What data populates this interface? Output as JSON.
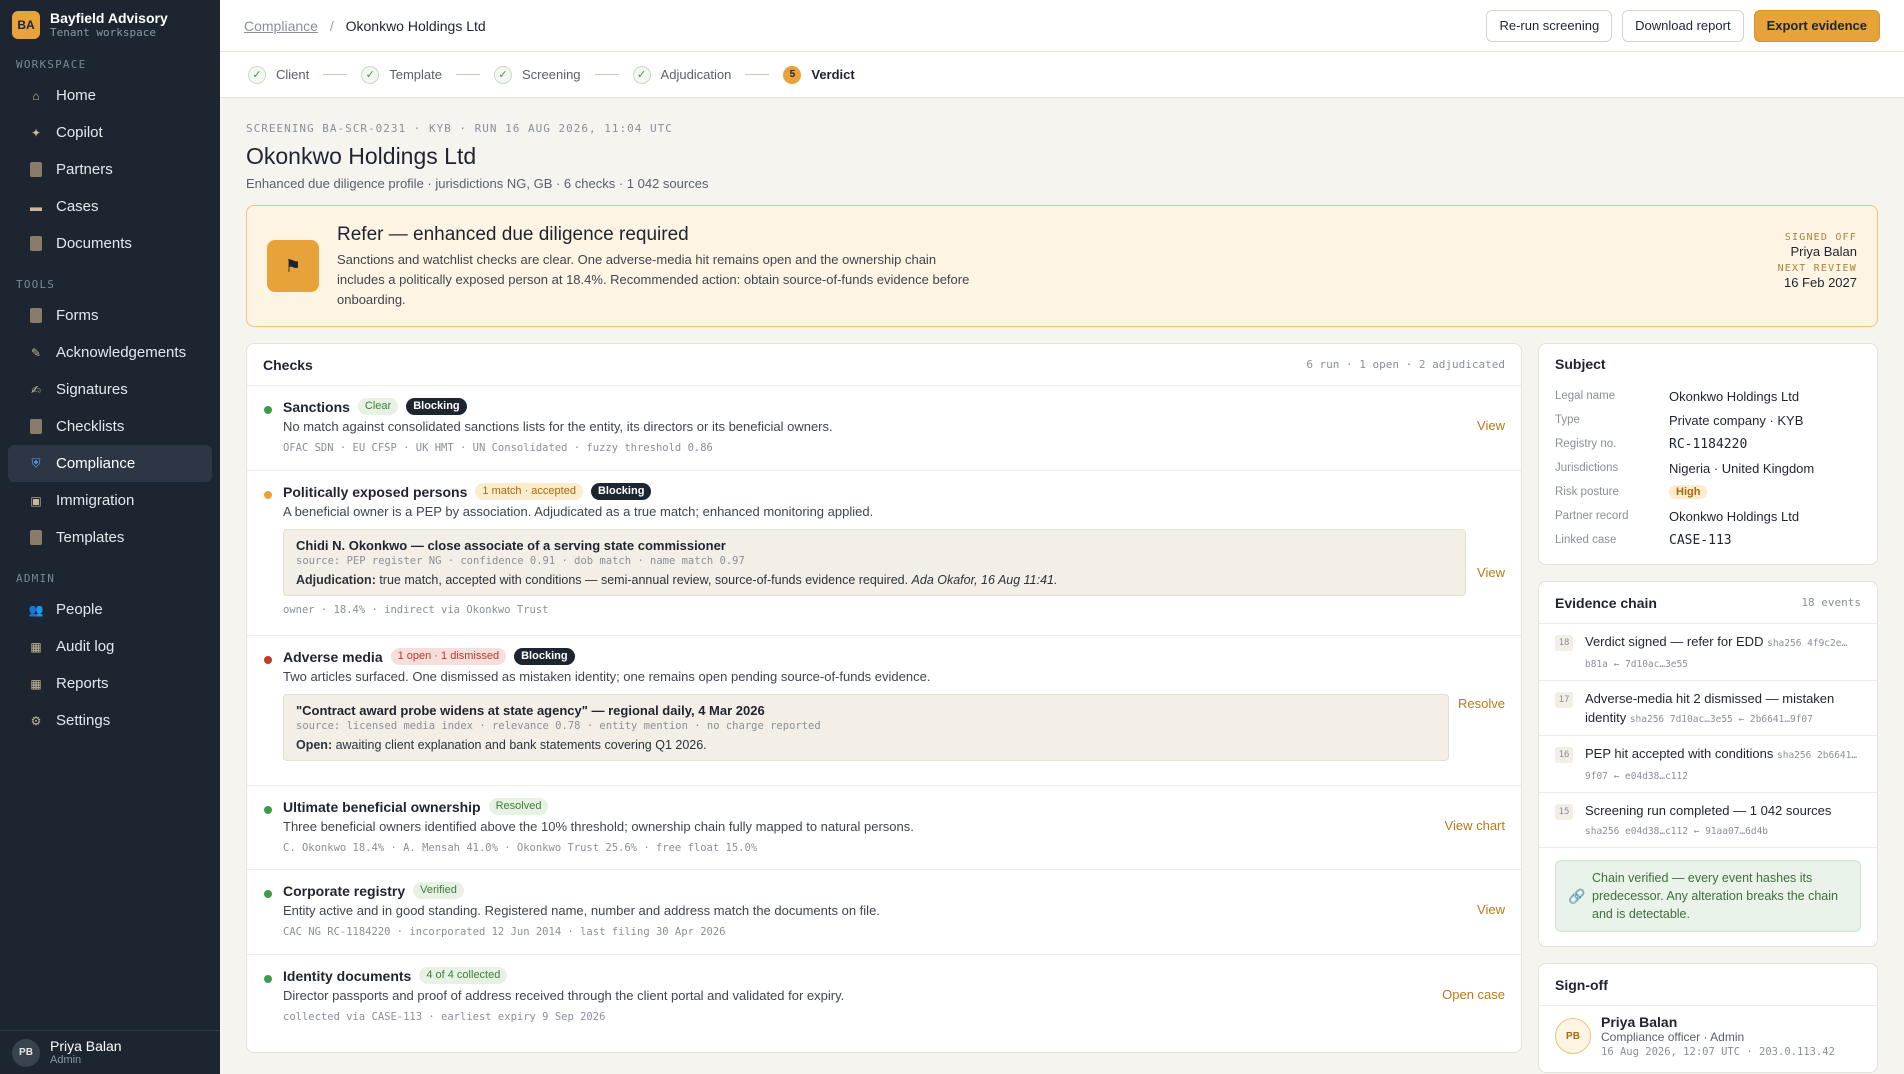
{
  "brand": {
    "logo": "BA",
    "name": "Bayfield Advisory",
    "sub": "Tenant workspace"
  },
  "nav": {
    "workspace_label": "WORKSPACE",
    "workspace": [
      {
        "label": "Home",
        "icon": "home-icon"
      },
      {
        "label": "Copilot",
        "icon": "sparkle-icon"
      },
      {
        "label": "Partners",
        "icon": "document-icon"
      },
      {
        "label": "Cases",
        "icon": "folder-icon"
      },
      {
        "label": "Documents",
        "icon": "document-icon"
      }
    ],
    "tools_label": "TOOLS",
    "tools": [
      {
        "label": "Forms",
        "icon": "document-icon"
      },
      {
        "label": "Acknowledgements",
        "icon": "pen-icon"
      },
      {
        "label": "Signatures",
        "icon": "signature-icon"
      },
      {
        "label": "Checklists",
        "icon": "document-icon"
      },
      {
        "label": "Compliance",
        "icon": "shield-icon",
        "active": true
      },
      {
        "label": "Immigration",
        "icon": "passport-icon"
      },
      {
        "label": "Templates",
        "icon": "document-icon"
      }
    ],
    "admin_label": "ADMIN",
    "admin": [
      {
        "label": "People",
        "icon": "people-icon"
      },
      {
        "label": "Audit log",
        "icon": "chart-icon"
      },
      {
        "label": "Reports",
        "icon": "chart-icon"
      },
      {
        "label": "Settings",
        "icon": "gear-icon"
      }
    ]
  },
  "user": {
    "initials": "PB",
    "name": "Priya Balan",
    "role": "Admin"
  },
  "breadcrumb": {
    "parent": "Compliance",
    "current": "Okonkwo Holdings Ltd"
  },
  "actions": {
    "rerun": "Re-run screening",
    "download": "Download report",
    "export": "Export evidence"
  },
  "steps": [
    {
      "label": "Client",
      "mark": "✓"
    },
    {
      "label": "Template",
      "mark": "✓"
    },
    {
      "label": "Screening",
      "mark": "✓"
    },
    {
      "label": "Adjudication",
      "mark": "✓"
    },
    {
      "label": "Verdict",
      "mark": "5",
      "current": true
    }
  ],
  "header": {
    "meta": "SCREENING BA-SCR-0231 · KYB · RUN 16 AUG 2026, 11:04 UTC",
    "title": "Okonkwo Holdings Ltd",
    "subline": "Enhanced due diligence profile · jurisdictions NG, GB · 6 checks · 1 042 sources"
  },
  "verdict": {
    "title": "Refer — enhanced due diligence required",
    "body": "Sanctions and watchlist checks are clear. One adverse-media hit remains open and the ownership chain includes a politically exposed person at 18.4%. Recommended action: obtain source-of-funds evidence before onboarding.",
    "signed_label": "SIGNED OFF",
    "signed_by": "Priya Balan",
    "review_label": "NEXT REVIEW",
    "review_date": "16 Feb 2027"
  },
  "checks": {
    "title": "Checks",
    "meta": "6 run · 1 open · 2 adjudicated",
    "items": [
      {
        "name": "Sanctions",
        "status": "Clear",
        "blocking": "Blocking",
        "desc": "No match against consolidated sanctions lists for the entity, its directors or its beneficial owners.",
        "foot": "OFAC SDN · EU CFSP · UK HMT · UN Consolidated · fuzzy threshold 0.86",
        "action": "View"
      },
      {
        "name": "Politically exposed persons",
        "status": "1 match · accepted",
        "blocking": "Blocking",
        "desc": "A beneficial owner is a PEP by association. Adjudicated as a true match; enhanced monitoring applied.",
        "finding": {
          "title": "Chidi N. Okonkwo — close associate of a serving state commissioner",
          "src": "source: PEP register NG · confidence 0.91 · dob match · name match 0.97",
          "note_label": "Adjudication:",
          "note": " true match, accepted with conditions — semi-annual review, source-of-funds evidence required. ",
          "note_who": "Ada Okafor, 16 Aug 11:41."
        },
        "foot": "owner · 18.4% · indirect via Okonkwo Trust",
        "action": "View"
      },
      {
        "name": "Adverse media",
        "status": "1 open · 1 dismissed",
        "blocking": "Blocking",
        "desc": "Two articles surfaced. One dismissed as mistaken identity; one remains open pending source-of-funds evidence.",
        "finding": {
          "title": "\"Contract award probe widens at state agency\" — regional daily, 4 Mar 2026",
          "src": "source: licensed media index · relevance 0.78 · entity mention · no charge reported",
          "note_label": "Open:",
          "note": " awaiting client explanation and bank statements covering Q1 2026."
        },
        "action": "Resolve"
      },
      {
        "name": "Ultimate beneficial ownership",
        "status": "Resolved",
        "desc": "Three beneficial owners identified above the 10% threshold; ownership chain fully mapped to natural persons.",
        "foot": "C. Okonkwo 18.4% · A. Mensah 41.0% · Okonkwo Trust 25.6% · free float 15.0%",
        "action": "View chart"
      },
      {
        "name": "Corporate registry",
        "status": "Verified",
        "desc": "Entity active and in good standing. Registered name, number and address match the documents on file.",
        "foot": "CAC NG RC-1184220 · incorporated 12 Jun 2014 · last filing 30 Apr 2026",
        "action": "View"
      },
      {
        "name": "Identity documents",
        "status": "4 of 4 collected",
        "desc": "Director passports and proof of address received through the client portal and validated for expiry.",
        "foot": "collected via CASE-113 · earliest expiry 9 Sep 2026",
        "action": "Open case"
      }
    ]
  },
  "subject": {
    "title": "Subject",
    "rows": [
      {
        "k": "Legal name",
        "v": "Okonkwo Holdings Ltd"
      },
      {
        "k": "Type",
        "v": "Private company · KYB"
      },
      {
        "k": "Registry no.",
        "v": "RC-1184220"
      },
      {
        "k": "Jurisdictions",
        "v": "Nigeria · United Kingdom"
      },
      {
        "k": "Risk posture",
        "v": "High"
      },
      {
        "k": "Partner record",
        "v": "Okonkwo Holdings Ltd"
      },
      {
        "k": "Linked case",
        "v": "CASE-113"
      }
    ]
  },
  "evidence": {
    "title": "Evidence chain",
    "meta": "18 events",
    "events": [
      {
        "n": "18",
        "text": "Verdict signed — refer for EDD",
        "hash": "sha256 4f9c2e…b81a ← 7d10ac…3e55"
      },
      {
        "n": "17",
        "text": "Adverse-media hit 2 dismissed — mistaken identity",
        "hash": "sha256 7d10ac…3e55 ← 2b6641…9f07"
      },
      {
        "n": "16",
        "text": "PEP hit accepted with conditions",
        "hash": "sha256 2b6641…9f07 ← e04d38…c112"
      },
      {
        "n": "15",
        "text": "Screening run completed — 1 042 sources",
        "hash": "sha256 e04d38…c112 ← 91aa07…6d4b"
      }
    ],
    "chain_note": "Chain verified — every event hashes its predecessor. Any alteration breaks the chain and is detectable."
  },
  "signoff": {
    "title": "Sign-off",
    "initials": "PB",
    "name": "Priya Balan",
    "role": "Compliance officer · Admin",
    "stamp": "16 Aug 2026, 12:07 UTC · 203.0.113.42"
  },
  "colors": {
    "accent": "#e8a23a",
    "sidebar": "#1d2530",
    "ok": "#3f9a4a",
    "warn": "#e8a23a",
    "danger": "#c0392b"
  }
}
